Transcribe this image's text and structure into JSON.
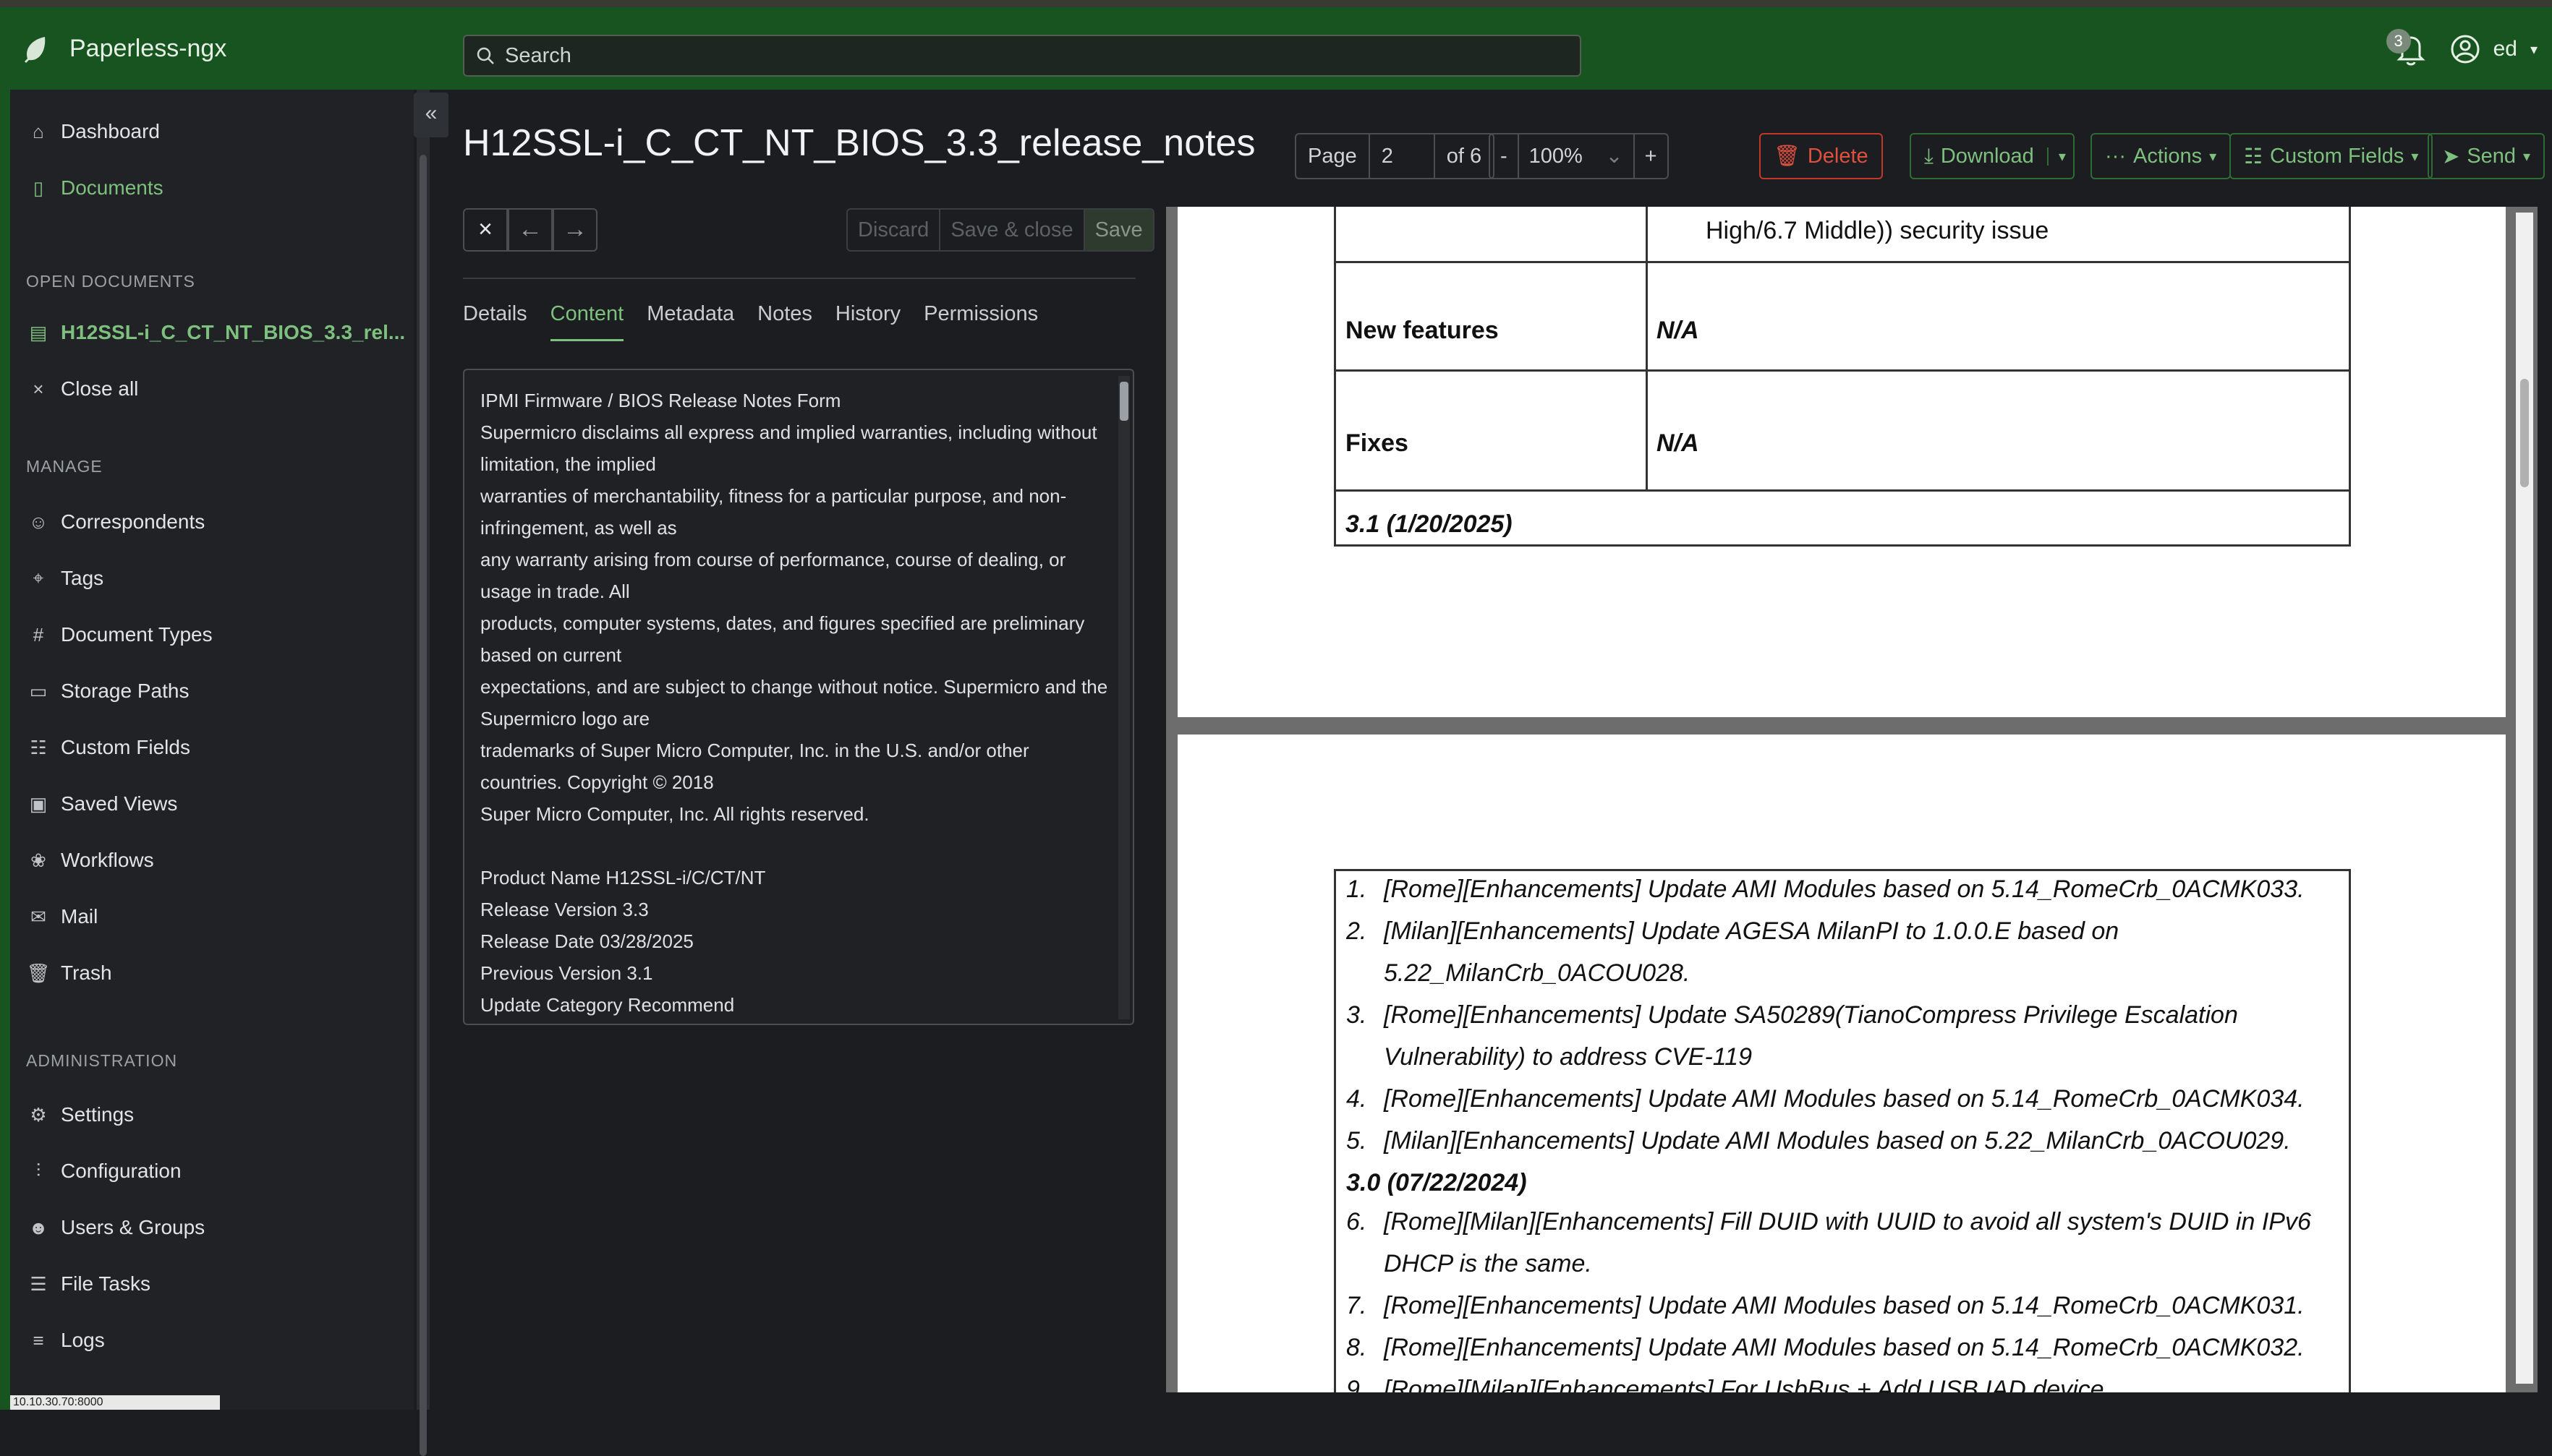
{
  "app": {
    "name": "Paperless-ngx"
  },
  "search": {
    "placeholder": "Search"
  },
  "notifications": {
    "count": "3"
  },
  "user": {
    "name": "ed"
  },
  "sidebar": {
    "nav": [
      {
        "label": "Dashboard",
        "icon": "house-icon"
      },
      {
        "label": "Documents",
        "icon": "file-icon"
      }
    ],
    "open_documents_heading": "OPEN DOCUMENTS",
    "open_document": "H12SSL-i_C_CT_NT_BIOS_3.3_rel...",
    "close_all": "Close all",
    "manage_heading": "MANAGE",
    "manage": [
      "Correspondents",
      "Tags",
      "Document Types",
      "Storage Paths",
      "Custom Fields",
      "Saved Views",
      "Workflows",
      "Mail",
      "Trash"
    ],
    "admin_heading": "ADMINISTRATION",
    "admin": [
      "Settings",
      "Configuration",
      "Users & Groups",
      "File Tasks",
      "Logs"
    ],
    "status_url": "10.10.30.70:8000"
  },
  "document": {
    "title": "H12SSL-i_C_CT_NT_BIOS_3.3_release_notes",
    "page_label": "Page",
    "page": "2",
    "of_pages": "of 6",
    "zoom_minus": "-",
    "zoom": "100%",
    "zoom_plus": "+",
    "delete": "Delete",
    "download": "Download",
    "actions": "Actions",
    "custom_fields": "Custom Fields",
    "send": "Send",
    "discard": "Discard",
    "save_close": "Save & close",
    "save": "Save",
    "tabs": [
      "Details",
      "Content",
      "Metadata",
      "Notes",
      "History",
      "Permissions"
    ],
    "content_lines": [
      "IPMI Firmware / BIOS Release Notes Form",
      "Supermicro disclaims all express and implied warranties, including without limitation, the implied",
      "warranties of merchantability, fitness for a particular purpose, and non-infringement, as well as",
      "any warranty arising from course of performance, course of dealing, or usage in trade. All",
      "products, computer systems, dates, and figures specified are preliminary based on current",
      "expectations, and are subject to change without notice. Supermicro and the Supermicro logo are",
      "trademarks of Super Micro Computer, Inc. in the U.S. and/or other countries. Copyright © 2018",
      "Super Micro Computer, Inc. All rights reserved.",
      "",
      "Product Name H12SSL-i/C/CT/NT",
      "Release Version 3.3",
      "Release Date 03/28/2025",
      "Previous Version 3.1",
      "Update Category Recommend"
    ]
  },
  "pdf": {
    "top_cell": "High/6.7 Middle)) security issue",
    "new_features_label": "New features",
    "new_features_value": "N/A",
    "fixes_label": "Fixes",
    "fixes_value": "N/A",
    "version_31": "3.1 (1/20/2025)",
    "items_a": [
      {
        "n": "1.",
        "t": "[Rome][Enhancements] Update AMI Modules based on 5.14_RomeCrb_0ACMK033."
      },
      {
        "n": "2.",
        "t": "[Milan][Enhancements] Update AGESA MilanPI to 1.0.0.E based on"
      },
      {
        "n": "",
        "t": "5.22_MilanCrb_0ACOU028."
      },
      {
        "n": "3.",
        "t": "[Rome][Enhancements] Update SA50289(TianoCompress Privilege Escalation"
      },
      {
        "n": "",
        "t": "Vulnerability) to address CVE-119"
      },
      {
        "n": "4.",
        "t": "[Rome][Enhancements] Update AMI Modules based on 5.14_RomeCrb_0ACMK034."
      },
      {
        "n": "5.",
        "t": "[Milan][Enhancements] Update AMI Modules based on 5.22_MilanCrb_0ACOU029."
      }
    ],
    "version_30": "3.0 (07/22/2024)",
    "items_b": [
      {
        "n": "6.",
        "t": "[Rome][Milan][Enhancements] Fill DUID with UUID to avoid all system's DUID in IPv6"
      },
      {
        "n": "",
        "t": "DHCP is the same."
      },
      {
        "n": "7.",
        "t": "[Rome][Enhancements] Update AMI Modules based on 5.14_RomeCrb_0ACMK031."
      },
      {
        "n": "8.",
        "t": "[Rome][Enhancements] Update AMI Modules based on 5.14_RomeCrb_0ACMK032."
      },
      {
        "n": "9.",
        "t": "[Rome][Milan][Enhancements] For UsbBus + Add USB IAD device class/subclass/protocol"
      }
    ]
  },
  "colors": {
    "topbar": "#17541f",
    "accent": "#7ec07e",
    "danger": "#e0503f"
  }
}
